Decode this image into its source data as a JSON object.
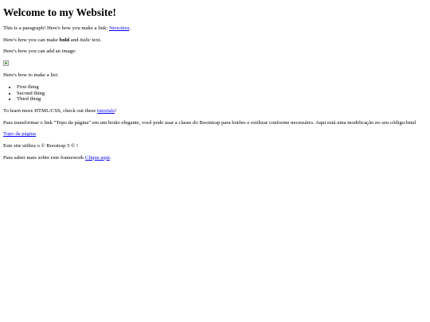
{
  "page": {
    "heading": "Welcome to my Website!",
    "intro": {
      "before_link": "This is a paragraph! Here's how you make a link: ",
      "link_text": "Neocities",
      "after_link": "."
    },
    "formatting": {
      "before_bold": "Here's how you can make ",
      "bold_text": "bold",
      "middle": " and ",
      "italic_text": "italic",
      "after_italic": " text."
    },
    "image_intro": "Here's how you can add an image:",
    "image_icon": "broken-image-icon",
    "list_intro": "Here's how to make a list:",
    "list_items": [
      "First thing",
      "Second thing",
      "Third thing"
    ],
    "learn_more": {
      "before_link": "To learn more HTML/CSS, check out these ",
      "link_text": "tutorials",
      "after_link": "!"
    },
    "bootstrap_note": "Para transformar o link \"Topo da página\" em um botão elegante, você pode usar a classe do Bootstrap para botões e estilizar conforme necessário. Aqui está uma modificação no seu código:html",
    "top_link": "Topo da página",
    "footer_note": "Este site utiliza o © Boostrap 5 © !",
    "framework": {
      "before_link": "Para saber mais sobre este framework ",
      "link_text": "Clique aqui",
      "after_link": "."
    },
    "link_color": "#0000ee"
  }
}
